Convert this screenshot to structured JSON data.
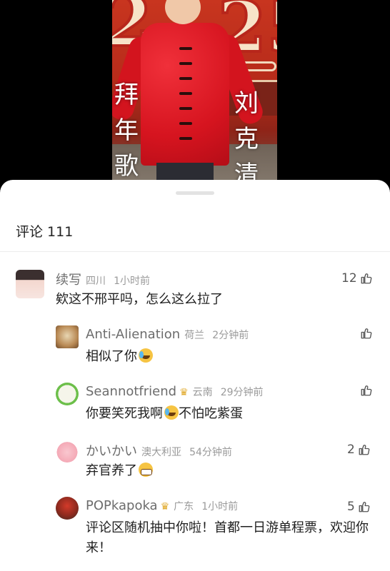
{
  "video": {
    "caption_left": [
      "拜",
      "年",
      "歌"
    ],
    "caption_right": [
      "刘",
      "克",
      "清"
    ],
    "backdrop_digits_left": "2",
    "backdrop_digits_right": "25"
  },
  "comments_sheet": {
    "title": "评论 111",
    "comments": [
      {
        "user": "续写",
        "location": "四川",
        "time": "1小时前",
        "text": "欸这不邢平吗，怎么这么拉了",
        "likes": "12",
        "avatar": "anime-girl-avatar"
      },
      {
        "user": "Anti-Alienation",
        "location": "荷兰",
        "time": "2分钟前",
        "text": "相似了你",
        "likes": "",
        "avatar": "cat-avatar",
        "emoji": "laughing-crying-emoji"
      },
      {
        "user": "Seannotfriend",
        "location": "云南",
        "time": "29分钟前",
        "text": "你要笑死我啊",
        "text2": "不怕吃紫蛋",
        "likes": "",
        "avatar": "cartoon-avatar",
        "emoji": "laughing-crying-emoji",
        "badge": "crown-badge"
      },
      {
        "user": "かいかい",
        "location": "澳大利亚",
        "time": "54分钟前",
        "text": "弃官养了",
        "likes": "2",
        "avatar": "pig-avatar",
        "emoji": "grinning-emoji"
      },
      {
        "user": "POPkapoka",
        "location": "广东",
        "time": "1小时前",
        "text": "评论区随机抽中你啦！首都一日游单程票，欢迎你来！",
        "likes": "5",
        "avatar": "illustrated-avatar",
        "badge": "crown-badge"
      }
    ]
  },
  "colors": {
    "accent": "#e0a92a",
    "jacket_red": "#d6141f"
  }
}
